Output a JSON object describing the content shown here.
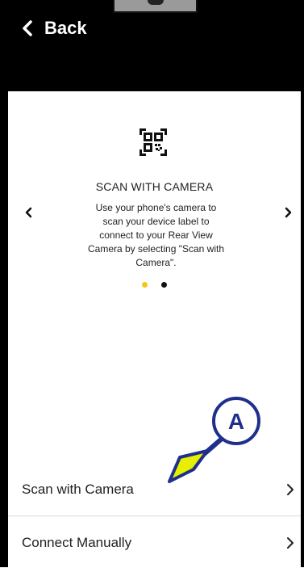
{
  "header": {
    "back_label": "Back"
  },
  "carousel": {
    "title": "SCAN WITH CAMERA",
    "description": "Use your phone's camera to scan your device label to connect to your Rear View Camera by selecting \"Scan with Camera\".",
    "page_count": 2,
    "active_page": 1
  },
  "options": [
    {
      "label": "Scan with Camera"
    },
    {
      "label": "Connect Manually"
    }
  ],
  "annotation": {
    "marker": "A"
  },
  "colors": {
    "header_bg": "#000000",
    "dot_active": "#f5c518",
    "dot_inactive": "#111111",
    "callout_blue": "#1e2f8c",
    "callout_arrow_fill": "#e6f000"
  },
  "icons": [
    "chevron-left-icon",
    "qr-code-icon",
    "chevron-right-icon"
  ]
}
